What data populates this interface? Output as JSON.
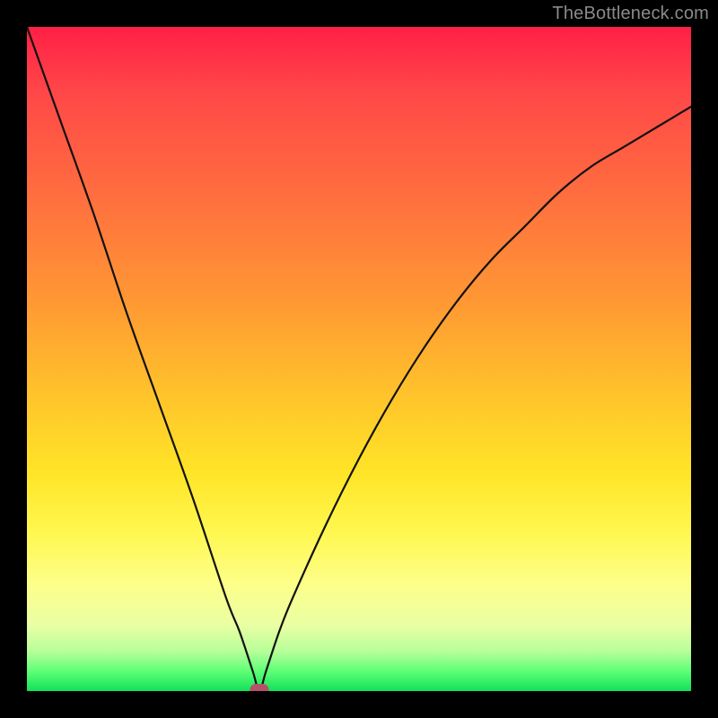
{
  "watermark": "TheBottleneck.com",
  "colors": {
    "page_bg": "#000000",
    "gradient_top": "#ff1f46",
    "gradient_mid1": "#ff9a33",
    "gradient_mid2": "#ffe427",
    "gradient_bottom": "#13e05a",
    "curve": "#111111",
    "marker": "#b4526a",
    "watermark": "#8a8a8a"
  },
  "chart_data": {
    "type": "line",
    "title": "",
    "xlabel": "",
    "ylabel": "",
    "xlim": [
      0,
      100
    ],
    "ylim": [
      0,
      100
    ],
    "annotations": [
      "TheBottleneck.com"
    ],
    "grid": false,
    "series": [
      {
        "name": "bottleneck-curve",
        "x": [
          0,
          5,
          10,
          15,
          20,
          25,
          30,
          32,
          34,
          35,
          36,
          38,
          40,
          45,
          50,
          55,
          60,
          65,
          70,
          75,
          80,
          85,
          90,
          95,
          100
        ],
        "y": [
          100,
          86,
          72,
          57,
          43,
          29,
          14,
          9,
          3,
          0,
          3,
          9,
          14,
          25,
          35,
          44,
          52,
          59,
          65,
          70,
          75,
          79,
          82,
          85,
          88
        ]
      }
    ],
    "marker": {
      "x": 35,
      "y": 0,
      "shape": "rounded-rect"
    }
  }
}
